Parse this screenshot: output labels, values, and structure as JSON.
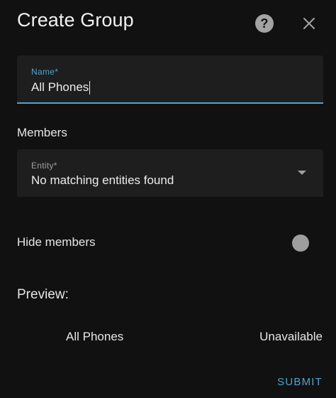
{
  "dialog": {
    "title": "Create Group",
    "help_icon": "help-circle-icon",
    "help_glyph": "?",
    "close_icon": "close-icon"
  },
  "name_field": {
    "label": "Name*",
    "value": "All Phones"
  },
  "members": {
    "label": "Members",
    "entity_field": {
      "label": "Entity*",
      "value": "No matching entities found",
      "icon": "chevron-down-icon"
    }
  },
  "hide_members": {
    "label": "Hide members",
    "enabled": false
  },
  "preview": {
    "label": "Preview:",
    "entity_name": "All Phones",
    "state": "Unavailable"
  },
  "actions": {
    "submit_label": "SUBMIT"
  },
  "colors": {
    "background": "#111111",
    "field_background": "#1e1e1e",
    "accent": "#4fa4cf",
    "text": "#e6e6e6",
    "muted": "#a0a0a0"
  }
}
